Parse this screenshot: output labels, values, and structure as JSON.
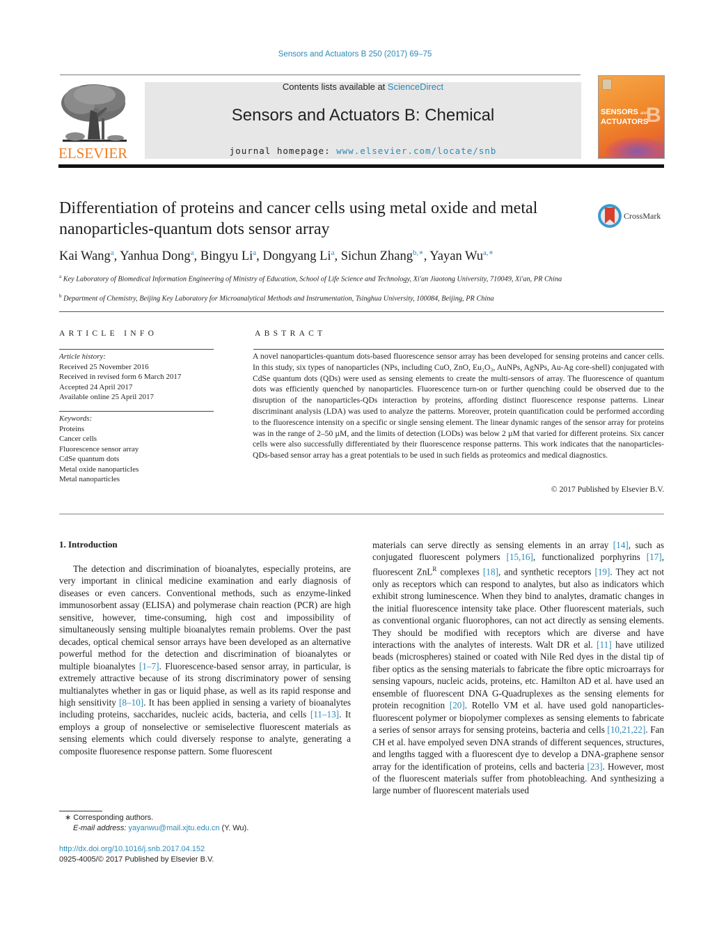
{
  "header": {
    "citation": "Sensors and Actuators B 250 (2017) 69–75",
    "contents_prefix": "Contents lists available at ",
    "contents_link": "ScienceDirect",
    "journal_title": "Sensors and Actuators B: Chemical",
    "homepage_prefix": "journal homepage: ",
    "homepage_link": "www.elsevier.com/locate/snb",
    "publisher_logo_text": "ELSEVIER",
    "cover": {
      "title_line1": "SENSORS",
      "title_small": "and",
      "title_line2": "ACTUATORS",
      "letter": "B"
    },
    "colors": {
      "link": "#2a8ab8",
      "elsevier_orange": "#f07d1e",
      "band": "#e7e7e7"
    }
  },
  "article": {
    "title": "Differentiation of proteins and cancer cells using metal oxide and metal nanoparticles-quantum dots sensor array",
    "crossmark_label": "CrossMark",
    "authors": [
      {
        "name": "Kai Wang",
        "sup": "a"
      },
      {
        "name": "Yanhua Dong",
        "sup": "a"
      },
      {
        "name": "Bingyu Li",
        "sup": "a"
      },
      {
        "name": "Dongyang Li",
        "sup": "a"
      },
      {
        "name": "Sichun Zhang",
        "sup": "b,∗"
      },
      {
        "name": "Yayan Wu",
        "sup": "a,∗"
      }
    ],
    "affiliations": [
      {
        "key": "a",
        "text": "Key Laboratory of Biomedical Information Engineering of Ministry of Education, School of Life Science and Technology, Xi'an Jiaotong University, 710049, Xi'an, PR China"
      },
      {
        "key": "b",
        "text": "Department of Chemistry, Beijing Key Laboratory for Microanalytical Methods and Instrumentation, Tsinghua University, 100084, Beijing, PR China"
      }
    ]
  },
  "article_info": {
    "heading": "ARTICLE INFO",
    "history_label": "Article history:",
    "history": [
      "Received 25 November 2016",
      "Received in revised form 6 March 2017",
      "Accepted 24 April 2017",
      "Available online 25 April 2017"
    ],
    "keywords_label": "Keywords:",
    "keywords": [
      "Proteins",
      "Cancer cells",
      "Fluorescence sensor array",
      "CdSe quantum dots",
      "Metal oxide nanoparticles",
      "Metal nanoparticles"
    ]
  },
  "abstract": {
    "heading": "ABSTRACT",
    "text": "A novel nanoparticles-quantum dots-based fluorescence sensor array has been developed for sensing proteins and cancer cells. In this study, six types of nanoparticles (NPs, including CuO, ZnO, Eu₂O₃, AuNPs, AgNPs, Au-Ag core-shell) conjugated with CdSe quantum dots (QDs) were used as sensing elements to create the multi-sensors of array. The fluorescence of quantum dots was efficiently quenched by nanoparticles. Fluorescence turn-on or further quenching could be observed due to the disruption of the nanoparticles-QDs interaction by proteins, affording distinct fluorescence response patterns. Linear discriminant analysis (LDA) was used to analyze the patterns. Moreover, protein quantification could be performed according to the fluorescence intensity on a specific or single sensing element. The linear dynamic ranges of the sensor array for proteins was in the range of 2–50 µM, and the limits of detection (LODs) was below 2 µM that varied for different proteins. Six cancer cells were also successfully differentiated by their fluorescence response patterns. This work indicates that the nanoparticles-QDs-based sensor array has a great potentials to be used in such fields as proteomics and medical diagnostics.",
    "copyright": "© 2017 Published by Elsevier B.V."
  },
  "body": {
    "section_heading": "1.  Introduction",
    "left_column": [
      {
        "t": "The detection and discrimination of bioanalytes, especially proteins, are very important in clinical medicine examination and early diagnosis of diseases or even cancers. Conventional methods, such as enzyme-linked immunosorbent assay (ELISA) and polymerase chain reaction (PCR) are high sensitive, however, time-consuming, high cost and impossibility of simultaneously sensing multiple bioanalytes remain problems. Over the past decades, optical chemical sensor arrays have been developed as an alternative powerful method for the detection and discrimination of bioanalytes or multiple bioanalytes "
      },
      {
        "ref": "[1–7]"
      },
      {
        "t": ". Fluorescence-based sensor array, in particular, is extremely attractive because of its strong discriminatory power of sensing multianalytes whether in gas or liquid phase, as well as its rapid response and high sensitivity "
      },
      {
        "ref": "[8–10]"
      },
      {
        "t": ". It has been applied in sensing a variety of bioanalytes including proteins, saccharides, nucleic acids, bacteria, and cells "
      },
      {
        "ref": "[11–13]"
      },
      {
        "t": ". It employs a group of nonselective or semiselective fluorescent materials as sensing elements which could diversely response to analyte, generating a composite fluoresence response pattern. Some fluorescent"
      }
    ],
    "right_column": [
      {
        "t": "materials can serve directly as sensing elements in an array "
      },
      {
        "ref": "[14]"
      },
      {
        "t": ", such as conjugated fluorescent polymers "
      },
      {
        "ref": "[15,16]"
      },
      {
        "t": ", functionalized porphyrins "
      },
      {
        "ref": "[17]"
      },
      {
        "t": ", fluorescent ZnL"
      },
      {
        "sup": "R"
      },
      {
        "t": " complexes "
      },
      {
        "ref": "[18]"
      },
      {
        "t": ", and synthetic receptors "
      },
      {
        "ref": "[19]"
      },
      {
        "t": ". They act not only as receptors which can respond to analytes, but also as indicators which exhibit strong luminescence. When they bind to analytes, dramatic changes in the initial fluorescence intensity take place. Other fluorescent materials, such as conventional organic fluorophores, can not act directly as sensing elements. They should be modified with receptors which are diverse and have interactions with the analytes of interests. Walt DR et al. "
      },
      {
        "ref": "[11]"
      },
      {
        "t": " have utilized beads (microspheres) stained or coated with Nile Red dyes in the distal tip of fiber optics as the sensing materials to fabricate the fibre optic microarrays for sensing vapours, nucleic acids, proteins, etc. Hamilton AD et al. have used an ensemble of fluorescent DNA G-Quadruplexes as the sensing elements for protein recognition "
      },
      {
        "ref": "[20]"
      },
      {
        "t": ". Rotello VM et al. have used gold nanoparticles-fluorescent polymer or biopolymer complexes as sensing elements to fabricate a series of sensor arrays for sensing proteins, bacteria and cells "
      },
      {
        "ref": "[10,21,22]"
      },
      {
        "t": ". Fan CH et al. have empolyed seven DNA strands of different sequences, structures, and lengths tagged with a fluorescent dye to develop a DNA-graphene sensor array for the identification of proteins, cells and bacteria "
      },
      {
        "ref": "[23]"
      },
      {
        "t": ". However, most of the fluorescent materials suffer from photobleaching. And synthesizing a large number of fluorescent materials used"
      }
    ]
  },
  "footnotes": {
    "star": "∗",
    "corresponding": "Corresponding authors.",
    "email_label": "E-mail address:",
    "email": "yayanwu@mail.xjtu.edu.cn",
    "email_suffix": " (Y. Wu).",
    "doi_link": "http://dx.doi.org/10.1016/j.snb.2017.04.152",
    "issn_line": "0925-4005/© 2017 Published by Elsevier B.V."
  }
}
